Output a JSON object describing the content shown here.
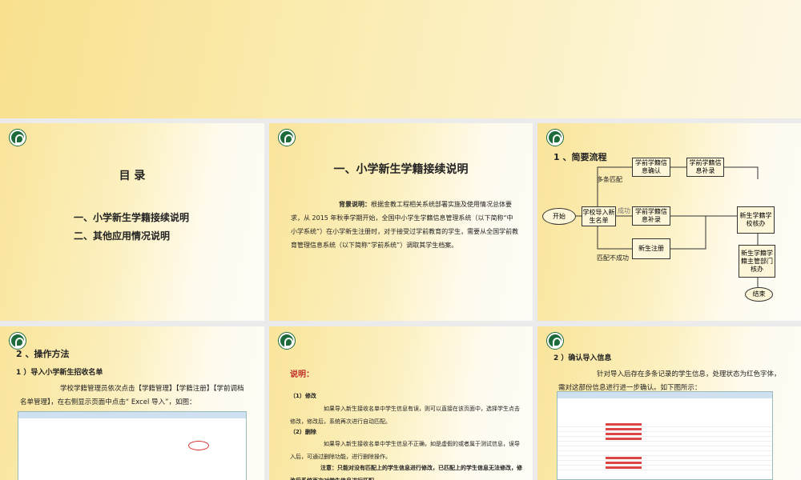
{
  "slides": [
    {
      "title": "目 录",
      "items": [
        "一、小学新生学籍接续说明",
        "二、其他应用情况说明"
      ]
    },
    {
      "title": "一、小学新生学籍接续说明",
      "label": "背景说明：",
      "text": "根据金教工程相关系统部署实施及使用情况总体要求，从 2015 年秋季学期开始，全国中小学生学籍信息管理系统（以下简称“中小学系统”）在小学新生注册时，对于接受过学前教育的学生，需要从全国学前教育管理信息系统（以下简称“学前系统”）调取其学生档案。"
    },
    {
      "title": "1 、简要流程",
      "flow": {
        "start": "开始",
        "import": "学校导入新生名单",
        "multi": "多条匹配",
        "success": "成功",
        "fail": "匹配不成功",
        "confirm": "学前学籍信息确认",
        "supp1": "学前学籍信息补录",
        "supp2": "学前学籍信息补录",
        "register": "新生注册",
        "school": "新生学籍学校核办",
        "dept": "新生学籍学籍主管部门核办",
        "end": "结束"
      }
    },
    {
      "title": "2 、操作方法",
      "subtitle": "1 ）导入小学新生招收名单",
      "text": "学校学籍管理员依次点击【学籍管理】【学籍注册】【学前调档名单管理】，在右侧显示页面中点击“ Excel 导入”，如图："
    },
    {
      "title": "说明：",
      "s1": "（1）修改",
      "t1": "如果导入新生接收名单中学生信息有误，则可以直接在该页面中，选择学生点击修改，修改后，系统再次进行自动匹配。",
      "s2": "（2）删除",
      "t2": "如果导入新生接收名单中学生信息不正确，如是虚假的或者属于测试信息，误导入后，可通过删除功能，进行删除操作。",
      "note": "注意：只能对没有匹配上的学生信息进行修改，已匹配上的学生信息无法修改，修改后系统再次对学生信息进行匹配。"
    },
    {
      "title": "2 ）确认导入信息",
      "text": "针对导入后存在多条记录的学生信息，处理状态为红色字体，需对这部份信息进行进一步确认。如下图所示："
    }
  ]
}
